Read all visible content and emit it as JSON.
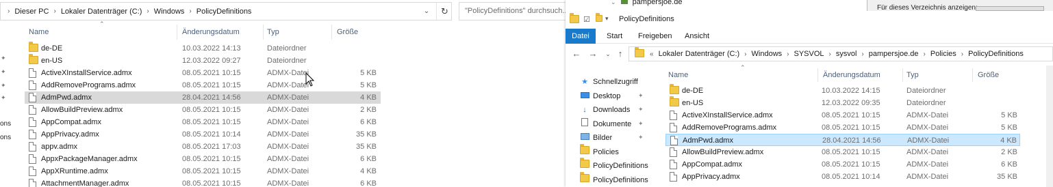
{
  "left": {
    "breadcrumb": [
      "Dieser PC",
      "Lokaler Datenträger (C:)",
      "Windows",
      "PolicyDefinitions"
    ],
    "search_placeholder": "\"PolicyDefinitions\" durchsuch...",
    "nav_fragments": [
      "ons",
      "ons"
    ],
    "columns": {
      "name": "Name",
      "date": "Änderungsdatum",
      "type": "Typ",
      "size": "Größe"
    },
    "rows": [
      {
        "name": "de-DE",
        "date": "10.03.2022 14:13",
        "type": "Dateiordner",
        "size": "",
        "icon": "folder-icon"
      },
      {
        "name": "en-US",
        "date": "12.03.2022 09:27",
        "type": "Dateiordner",
        "size": "",
        "icon": "folder-icon"
      },
      {
        "name": "ActiveXInstallService.admx",
        "date": "08.05.2021 10:15",
        "type": "ADMX-Datei",
        "size": "5 KB",
        "icon": "file-icon"
      },
      {
        "name": "AddRemovePrograms.admx",
        "date": "08.05.2021 10:15",
        "type": "ADMX-Datei",
        "size": "5 KB",
        "icon": "file-icon"
      },
      {
        "name": "AdmPwd.admx",
        "date": "28.04.2021 14:56",
        "type": "ADMX-Datei",
        "size": "4 KB",
        "icon": "file-icon",
        "selected": true
      },
      {
        "name": "AllowBuildPreview.admx",
        "date": "08.05.2021 10:15",
        "type": "ADMX-Datei",
        "size": "2 KB",
        "icon": "file-icon"
      },
      {
        "name": "AppCompat.admx",
        "date": "08.05.2021 10:15",
        "type": "ADMX-Datei",
        "size": "6 KB",
        "icon": "file-icon"
      },
      {
        "name": "AppPrivacy.admx",
        "date": "08.05.2021 10:14",
        "type": "ADMX-Datei",
        "size": "35 KB",
        "icon": "file-icon"
      },
      {
        "name": "appv.admx",
        "date": "08.05.2021 17:03",
        "type": "ADMX-Datei",
        "size": "35 KB",
        "icon": "file-icon"
      },
      {
        "name": "AppxPackageManager.admx",
        "date": "08.05.2021 10:15",
        "type": "ADMX-Datei",
        "size": "6 KB",
        "icon": "file-icon"
      },
      {
        "name": "AppXRuntime.admx",
        "date": "08.05.2021 10:15",
        "type": "ADMX-Datei",
        "size": "4 KB",
        "icon": "file-icon"
      },
      {
        "name": "AttachmentManager.admx",
        "date": "08.05.2021 10:15",
        "type": "ADMX-Datei",
        "size": "6 KB",
        "icon": "file-icon"
      }
    ]
  },
  "right": {
    "background_tree_item": "pampersjoe.de",
    "background_panel_text": "Für dieses Verzeichnis anzeigen:",
    "title": "PolicyDefinitions",
    "ribbon_tabs": [
      "Datei",
      "Start",
      "Freigeben",
      "Ansicht"
    ],
    "breadcrumb": [
      "Lokaler Datenträger (C:)",
      "Windows",
      "SYSVOL",
      "sysvol",
      "pampersjoe.de",
      "Policies",
      "PolicyDefinitions"
    ],
    "nav_items": [
      {
        "label": "Schnellzugriff",
        "icon": "star-icon"
      },
      {
        "label": "Desktop",
        "icon": "desktop-icon",
        "pinned": true
      },
      {
        "label": "Downloads",
        "icon": "download-icon",
        "pinned": true
      },
      {
        "label": "Dokumente",
        "icon": "documents-icon",
        "pinned": true
      },
      {
        "label": "Bilder",
        "icon": "pictures-icon",
        "pinned": true
      },
      {
        "label": "Policies",
        "icon": "folder-icon"
      },
      {
        "label": "PolicyDefinitions",
        "icon": "folder-icon"
      },
      {
        "label": "PolicyDefinitions",
        "icon": "folder-icon"
      }
    ],
    "columns": {
      "name": "Name",
      "date": "Änderungsdatum",
      "type": "Typ",
      "size": "Größe"
    },
    "rows": [
      {
        "name": "de-DE",
        "date": "10.03.2022 14:15",
        "type": "Dateiordner",
        "size": "",
        "icon": "folder-icon"
      },
      {
        "name": "en-US",
        "date": "12.03.2022 09:35",
        "type": "Dateiordner",
        "size": "",
        "icon": "folder-icon"
      },
      {
        "name": "ActiveXInstallService.admx",
        "date": "08.05.2021 10:15",
        "type": "ADMX-Datei",
        "size": "5 KB",
        "icon": "file-icon"
      },
      {
        "name": "AddRemovePrograms.admx",
        "date": "08.05.2021 10:15",
        "type": "ADMX-Datei",
        "size": "5 KB",
        "icon": "file-icon"
      },
      {
        "name": "AdmPwd.admx",
        "date": "28.04.2021 14:56",
        "type": "ADMX-Datei",
        "size": "4 KB",
        "icon": "file-icon",
        "selected": true
      },
      {
        "name": "AllowBuildPreview.admx",
        "date": "08.05.2021 10:15",
        "type": "ADMX-Datei",
        "size": "2 KB",
        "icon": "file-icon"
      },
      {
        "name": "AppCompat.admx",
        "date": "08.05.2021 10:15",
        "type": "ADMX-Datei",
        "size": "6 KB",
        "icon": "file-icon"
      },
      {
        "name": "AppPrivacy.admx",
        "date": "08.05.2021 10:14",
        "type": "ADMX-Datei",
        "size": "35 KB",
        "icon": "file-icon"
      }
    ]
  }
}
